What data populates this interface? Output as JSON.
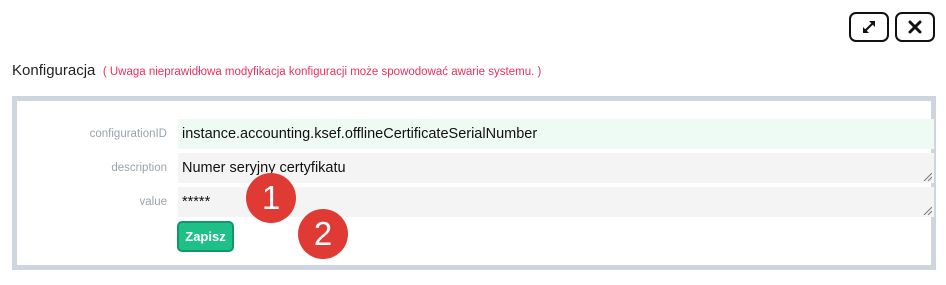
{
  "window_controls": {
    "expand_icon": "expand-arrows-icon",
    "close_icon": "x-icon"
  },
  "header": {
    "title": "Konfiguracja",
    "warning": "( Uwaga nieprawidłowa modyfikacja konfiguracji może spowodować awarie systemu. )"
  },
  "form": {
    "fields": [
      {
        "label": "configurationID",
        "value": "instance.accounting.ksef.offlineCertificateSerialNumber"
      },
      {
        "label": "description",
        "value": "Numer seryjny certyfikatu"
      },
      {
        "label": "value",
        "value": "*****"
      }
    ],
    "save_label": "Zapisz"
  },
  "annotations": [
    "1",
    "2"
  ],
  "colors": {
    "accent_green": "#1ec087",
    "warning_red": "#e8305a",
    "annotation_red": "#e03a34",
    "panel_border": "#cfd5de"
  }
}
